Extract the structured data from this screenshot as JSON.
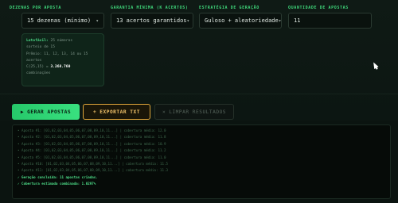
{
  "labels": {
    "dezenas": "DEZENAS POR APOSTA",
    "garantia": "GARANTIA MÍNIMA (K ACERTOS)",
    "estrategia": "ESTRATÉGIA DE GERAÇÃO",
    "quantidade": "QUANTIDADE DE APOSTAS"
  },
  "fields": {
    "dezenas_value": "15 dezenas (mínimo)",
    "garantia_value": "13 acertos garantidos",
    "estrategia_value": "Guloso + aleatoriedade",
    "quantidade_value": "11"
  },
  "info": {
    "line1_strong": "Lotofácil:",
    "line1_rest": " 25 números",
    "line2": "sorteio de 15",
    "line3": "Prêmio: 11, 12, 13, 14 ou 15",
    "line4": "acertos",
    "line5_pre": "C(25,15) = ",
    "line5_strong": "3.268.760",
    "line6": "combinações"
  },
  "buttons": {
    "gerar": "GERAR APOSTAS",
    "exportar": "EXPORTAR TXT",
    "limpar": "LIMPAR RESULTADOS"
  },
  "icons": {
    "gerar": "▶",
    "exportar": "+",
    "limpar": "×"
  },
  "log": {
    "lines": [
      "• Aposta #1: [01,02,03,04,05,06,07,08,09,10,11...] | cobertura média: 12.0",
      "• Aposta #2: [01,02,03,04,05,06,07,08,09,10,11...] | cobertura média: 11.8",
      "• Aposta #3: [01,02,03,04,05,06,07,08,09,10,11...] | cobertura média: 10.9",
      "• Aposta #4: [01,02,03,04,05,06,07,08,09,10,11...] | cobertura média: 11.2",
      "• Aposta #5: [01,02,03,04,05,06,07,08,09,10,11...] | cobertura média: 11.0",
      "• Aposta #10: [01,02,03,04,05,06,07,08,09,10,11...] | cobertura média: 11.5",
      "• Aposta #11: [01,02,03,04,05,06,07,08,09,10,11...] | cobertura média: 11.3"
    ],
    "done": "✓ Geração concluída: 11 apostas criadas.",
    "coverage": "✓ Cobertura estimada combinada: 1.0297%"
  }
}
